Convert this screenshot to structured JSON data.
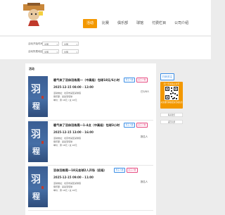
{
  "header": {
    "logo_icon": "mascot-logo-icon",
    "nav": [
      {
        "label": "活动",
        "active": true
      },
      {
        "label": "比赛",
        "active": false
      },
      {
        "label": "俱乐部",
        "active": false
      },
      {
        "label": "球馆",
        "active": false
      },
      {
        "label": "付费栏目",
        "active": false
      },
      {
        "label": "公司介绍",
        "active": false
      }
    ]
  },
  "filters": {
    "rows": [
      {
        "label": "活动开始时间",
        "select1": "全部",
        "select2": "全部"
      },
      {
        "label": "活动所属地区",
        "select1": "全部",
        "select2": "全部"
      }
    ]
  },
  "list": {
    "title": "活动",
    "cards": [
      {
        "title": "暖气来了羽体羽练周一（中高级）包球18元/6小时",
        "tags": [
          "男子人数",
          "女子人数"
        ],
        "time": "2025-12-15 08:00 - 12:00",
        "lines": [
          "活动地址：北京市某区某球馆",
          "俱乐部：某某羽毛球",
          "单价：男 18元 / 女 18元"
        ],
        "count": "已3/8人",
        "thumb_glyphs": [
          "羽",
          "程"
        ]
      },
      {
        "title": "暖气来了羽体羽练周一1-4点（中高级）包球3小时",
        "tags": [
          "男子人数",
          "女子人数"
        ],
        "time": "2025-12-15 13:00 - 16:00",
        "lines": [
          "活动地址：北京市某区某球馆",
          "俱乐部：某某羽毛球",
          "单价：男 18元 / 女 18元"
        ],
        "count": "报名人",
        "thumb_glyphs": [
          "羽",
          "程"
        ]
      },
      {
        "title": "羽体羽练周一18元含球2人开场（初级）",
        "tags": [
          "男子人数",
          "女子人数"
        ],
        "time": "2025-12-15 09:00 - 11:00",
        "lines": [
          "活动地址：北京市某区某球馆",
          "俱乐部：某某羽毛球",
          "单价：男 18元 / 女 18元"
        ],
        "count": "报名人",
        "thumb_glyphs": [
          "羽",
          "程"
        ]
      }
    ]
  },
  "side": {
    "badge": "扫码关注",
    "qr_caption": "扫一扫关注公众号",
    "qr_sub": "关注我们获取更多活动信息",
    "bars": [
      "联系我们",
      "返回顶部"
    ]
  },
  "colors": {
    "accent": "#f39800",
    "tag_blue": "#3a8ee6",
    "tag_pink": "#e64980"
  }
}
